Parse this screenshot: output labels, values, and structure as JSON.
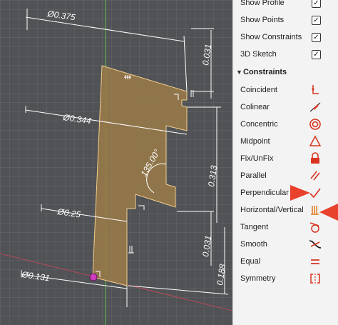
{
  "options": [
    {
      "label": "Show Profile",
      "checked": true
    },
    {
      "label": "Show Points",
      "checked": true
    },
    {
      "label": "Show Constraints",
      "checked": true
    },
    {
      "label": "3D Sketch",
      "checked": true
    }
  ],
  "check_glyph": "✓",
  "constraints_section": {
    "expand_glyph": "▼",
    "title": "Constraints"
  },
  "constraints": [
    {
      "label": "Coincident",
      "icon": "coincident-icon"
    },
    {
      "label": "Colinear",
      "icon": "colinear-icon"
    },
    {
      "label": "Concentric",
      "icon": "concentric-icon"
    },
    {
      "label": "Midpoint",
      "icon": "midpoint-icon"
    },
    {
      "label": "Fix/UnFix",
      "icon": "lock-icon"
    },
    {
      "label": "Parallel",
      "icon": "parallel-icon"
    },
    {
      "label": "Perpendicular",
      "icon": "perpendicular-icon"
    },
    {
      "label": "Horizontal/Vertical",
      "icon": "horizontal-vertical-icon"
    },
    {
      "label": "Tangent",
      "icon": "tangent-icon"
    },
    {
      "label": "Smooth",
      "icon": "smooth-icon"
    },
    {
      "label": "Equal",
      "icon": "equal-icon"
    },
    {
      "label": "Symmetry",
      "icon": "symmetry-icon"
    }
  ],
  "dimensions": {
    "width_top": "Ø0.375",
    "width_mid": "Ø0.344",
    "width_low": "Ø0.25",
    "width_bottom": "Ø0.131",
    "height_top_step": "0.031",
    "height_mid": "0.313",
    "height_notch": "0.031",
    "height_bottom": "0.188",
    "angle": "135.00°"
  },
  "colors": {
    "accent_red": "#e8412c",
    "profile_fill": "#9b7b4a",
    "icon_red": "#d9331f",
    "icon_orange": "#e07a1f",
    "viewport_bg": "#505255",
    "panel_bg": "#f3f3f3"
  }
}
